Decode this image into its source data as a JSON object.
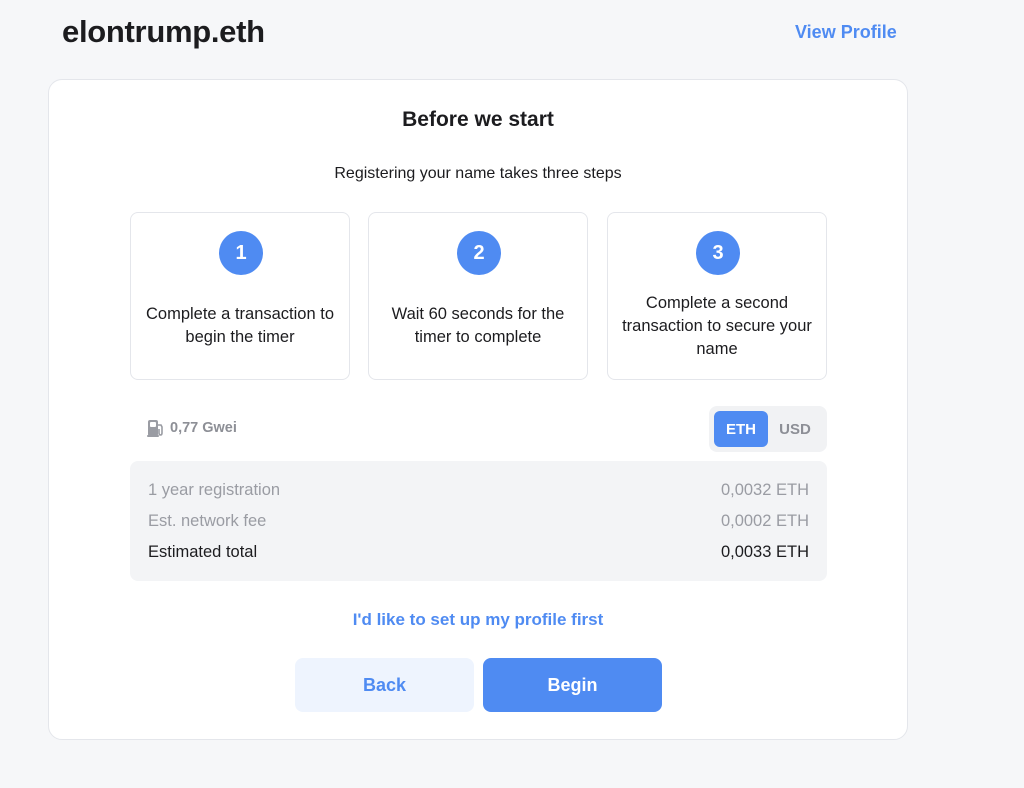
{
  "header": {
    "title": "elontrump.eth",
    "view_profile_label": "View Profile"
  },
  "card": {
    "title": "Before we start",
    "subtitle": "Registering your name takes three steps",
    "steps": [
      {
        "number": "1",
        "text": "Complete a transaction to begin the timer"
      },
      {
        "number": "2",
        "text": "Wait 60 seconds for the timer to complete"
      },
      {
        "number": "3",
        "text": "Complete a second transaction to secure your name"
      }
    ],
    "gas": {
      "icon": "gas-pump-icon",
      "value": "0,77 Gwei"
    },
    "currency_toggle": {
      "options": [
        "ETH",
        "USD"
      ],
      "selected": "ETH"
    },
    "pricing": {
      "rows": [
        {
          "label": "1 year registration",
          "value": "0,0032 ETH"
        },
        {
          "label": "Est. network fee",
          "value": "0,0002 ETH"
        },
        {
          "label": "Estimated total",
          "value": "0,0033 ETH"
        }
      ]
    },
    "profile_link_label": "I'd like to set up my profile first",
    "back_label": "Back",
    "begin_label": "Begin"
  },
  "colors": {
    "accent": "#4f8bf2",
    "background": "#f6f7f9",
    "muted_text": "#9a9ca3"
  }
}
